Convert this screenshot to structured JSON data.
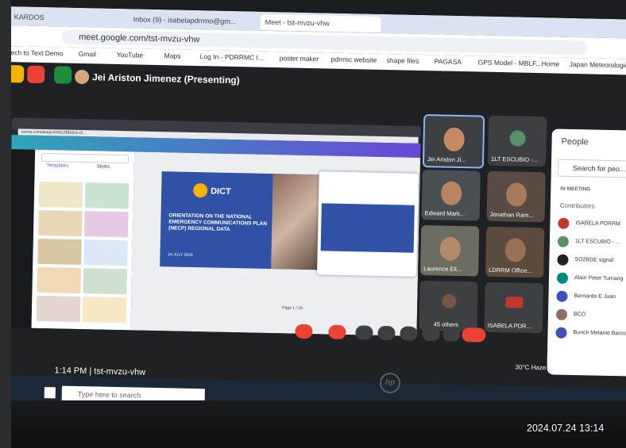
{
  "browser": {
    "tabs": [
      "KARDOS",
      "Inbox (9) - isabelapdrrmo@gm...",
      "Meet - tst-mvzu-vhw"
    ],
    "url": "meet.google.com/tst-mvzu-vhw",
    "bookmarks": [
      "eech to Text Demo",
      "Gmail",
      "YouTube",
      "Maps",
      "Log In - PDRRMC I...",
      "poster maker",
      "pdrrmc website",
      "shape files",
      "PAGASA",
      "GPS Model - MBLF...",
      "Home",
      "Japan Meteorologic..."
    ]
  },
  "meet": {
    "presenter_label": "Jei Ariston Jimenez (Presenting)",
    "meeting_code_time": "1:14 PM",
    "meeting_code": "tst-mvzu-vhw",
    "tiles": [
      {
        "name": "Jei Ariston Ji..."
      },
      {
        "name": "1LT ESCUBIO -..."
      },
      {
        "name": "Edward Mark..."
      },
      {
        "name": "Jonathan Ram..."
      },
      {
        "name": "Laurence Eli..."
      },
      {
        "name": "LDRRM Office..."
      },
      {
        "name": "45 others"
      },
      {
        "name": "ISABELA PDR..."
      }
    ]
  },
  "shared_screen": {
    "url": "canva.com/design/DAGJ38GEG-0/...",
    "panel_tabs": [
      "Templates",
      "Styles"
    ],
    "slide_title": "ORIENTATION ON THE NATIONAL EMERGENCY COMMUNICATIONS PLAN (NECP) REGIONAL DATA",
    "slide_brand": "DICT",
    "slide_date": "24 JULY 2024",
    "page_label": "Page 1 / 19"
  },
  "people_panel": {
    "title": "People",
    "search_placeholder": "Search for peo...",
    "section_in_meeting": "IN MEETING",
    "section_contributors": "Contributors",
    "list": [
      "ISABELA PDRRM",
      "1LT ESCUBIO - ...",
      "SO2BDE signal",
      "Alain Peter Tumang",
      "Bernardo E Juan",
      "BCO",
      "Bunch Melanie Barco"
    ]
  },
  "taskbar": {
    "search_placeholder": "Type here to search",
    "weather": "30°C Haze"
  },
  "timestamp": "2024.07.24 13:14",
  "colors": {
    "meet_bg": "#202124",
    "end_call": "#ea4335",
    "slide_blue": "#2f52a6"
  }
}
